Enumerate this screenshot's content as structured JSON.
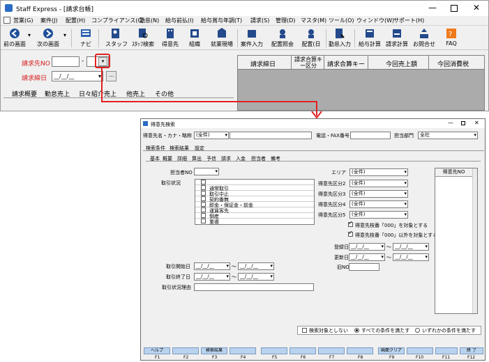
{
  "window": {
    "title": "Staff Express - [請求台帳]"
  },
  "menu": [
    "営業(G)",
    "案件(J)",
    "配置(H)",
    "コンプライアンス(C)",
    "勤怠(N)",
    "給与前払(I)",
    "給与賞与年調(T)",
    "請求(S)",
    "管理(D)",
    "マスタ(M)",
    "ツール(O)",
    "ウィンドウ(W)",
    "サポート(H)"
  ],
  "toolbar": [
    "前の画面",
    "次の画面",
    "ナビ",
    "スタッフ",
    "ｽﾀｯﾌ検索",
    "得意先",
    "組織",
    "就業現場",
    "案件入力",
    "配置照会",
    "配置(日",
    "勤怠入力",
    "給与計算",
    "請求計算",
    "お問合せ",
    "FAQ"
  ],
  "form": {
    "billing_no_label": "請求先NO",
    "billing_no_dash": "-",
    "closing_day_label": "請求締日",
    "date_placeholder": "__/__/__",
    "ellipsis": "..."
  },
  "main_tabs": [
    "請求概要",
    "勤怠売上",
    "日々紹介売上",
    "他売上",
    "その他"
  ],
  "grid_headers": [
    "請求締日",
    "請求合算キー区分",
    "請求合算キー",
    "今回売上額",
    "今回消費税"
  ],
  "dialog": {
    "title": "得意先検索",
    "name_label": "得意先名・カナ・略称",
    "name_mode": "(全件)",
    "phone_label": "電話・FAX番号",
    "dept_label": "担当部門",
    "dept_value": "全社",
    "top_tabs": [
      "検索条件",
      "検索結果",
      "設定"
    ],
    "sub_tabs": [
      "基本",
      "概要",
      "詳細",
      "算出",
      "予信",
      "請求",
      "入金",
      "担当者",
      "備考"
    ],
    "staff_no_label": "担当者NO",
    "status_label": "取引状況",
    "status_items": [
      "",
      "通常取引",
      "取引中止",
      "契約番無",
      "即金・保証金・前金",
      "運賃客先",
      "倒産",
      "重複"
    ],
    "area_label": "エリア",
    "area_value": "(全件)",
    "cls_labels": [
      "得意先区分2",
      "得意先区分3",
      "得意先区分4",
      "得意先区分5"
    ],
    "cls_value": "(全件)",
    "opt1": "得意先枝番「000」を対象とする",
    "opt2": "得意先枝番「000」以外を対象とする",
    "reg_date": "登録日",
    "upd_date": "更新日",
    "old_no": "旧NO",
    "start_label": "取引開始日",
    "end_label": "取引終了日",
    "reason_label": "取引状況理由",
    "result_header": "得意先NO",
    "tilde": "～",
    "cond_none": "検索対象としない",
    "cond_all": "すべての条件を満たす",
    "cond_any": "いずれかの条件を満たす",
    "fkeys": [
      "ヘルプ",
      "",
      "検索結果",
      "",
      "",
      "",
      "",
      "",
      "画面クリア",
      "",
      "",
      "終 了"
    ],
    "fnums": [
      "F1",
      "F2",
      "F3",
      "F4",
      "F5",
      "F6",
      "F7",
      "F8",
      "F9",
      "F10",
      "F11",
      "F12"
    ]
  }
}
